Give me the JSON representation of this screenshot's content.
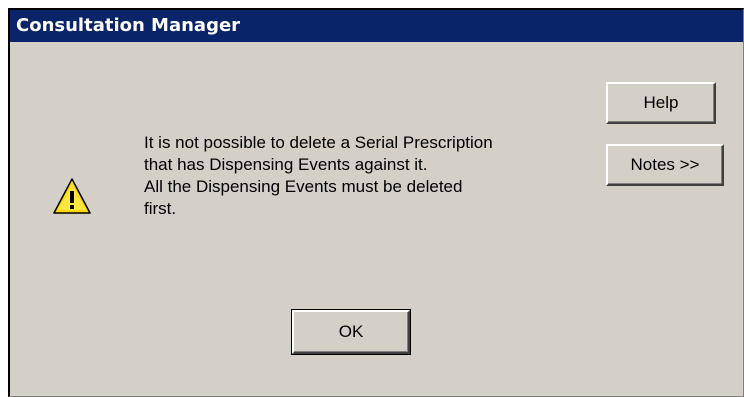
{
  "window": {
    "title": "Consultation Manager"
  },
  "message": {
    "icon": "warning-icon",
    "lines": [
      "It is not possible to delete a Serial Prescription",
      "that has Dispensing Events against it.",
      "All the Dispensing Events must be deleted",
      "first."
    ]
  },
  "buttons": {
    "help": "Help",
    "notes": "Notes >>",
    "ok": "OK"
  },
  "colors": {
    "titlebar": "#0a246a",
    "dialog_bg": "#d4d0c8",
    "warning_fill": "#ffd800"
  }
}
